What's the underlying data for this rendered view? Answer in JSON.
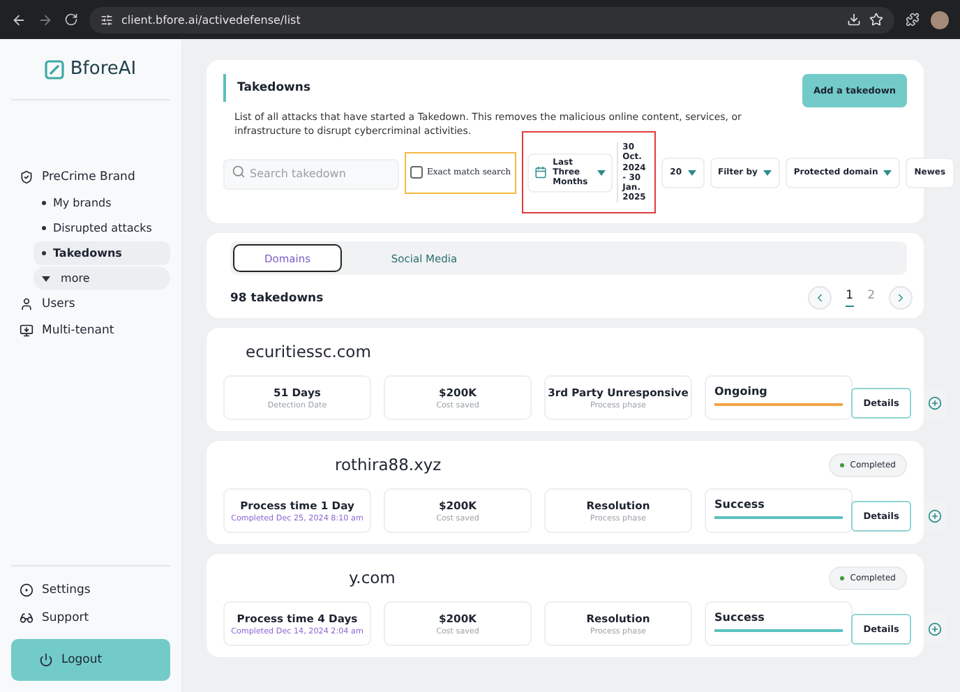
{
  "browser": {
    "url": "client.bfore.ai/activedefense/list"
  },
  "sidebar": {
    "logo": "BforeAI",
    "items": [
      {
        "label": "PreCrime Brand",
        "selected": false,
        "children": [
          {
            "label": "My brands",
            "kind": "sub",
            "selected": false
          },
          {
            "label": "Disrupted attacks",
            "kind": "sub",
            "selected": false
          },
          {
            "label": "Takedowns",
            "kind": "sub",
            "selected": true
          },
          {
            "label": "more",
            "kind": "more",
            "selected": false
          }
        ]
      },
      {
        "label": "Users",
        "selected": false
      },
      {
        "label": "Multi-tenant",
        "selected": false
      }
    ],
    "bottom": [
      {
        "label": "Settings"
      },
      {
        "label": "Support"
      }
    ],
    "logout": "Logout"
  },
  "header": {
    "title": "Takedowns",
    "description": "List of all attacks that have started a Takedown. This removes the malicious online content, services, or infrastructure to disrupt cybercriminal activities.",
    "add_button": "Add a takedown"
  },
  "filters": {
    "search_placeholder": "Search takedown",
    "exact_match": {
      "label": "Exact match search",
      "checked": false
    },
    "period": "Last Three Months",
    "date_range": "30 Oct. 2024 - 30 Jan. 2025",
    "page_size": "20",
    "filter_by": "Filter by",
    "protected_domain": "Protected domain",
    "sort": "Newes"
  },
  "tabs": [
    {
      "label": "Domains",
      "selected": true
    },
    {
      "label": "Social Media",
      "selected": false
    }
  ],
  "count": "98 takedowns",
  "pagination": {
    "pages": [
      {
        "label": "1",
        "selected": true
      },
      {
        "label": "2",
        "selected": false
      }
    ]
  },
  "takedowns": [
    {
      "domain": "ecuritiessc.com",
      "time": {
        "value": "51 Days",
        "label": "Detection Date",
        "kind": "detection"
      },
      "cost": {
        "value": "$200K",
        "label": "Cost saved"
      },
      "phase": {
        "value": "3rd Party Unresponsive",
        "label": "Process phase"
      },
      "status": {
        "label": "Ongoing",
        "kind": "ongoing"
      },
      "details": "Details"
    },
    {
      "domain": "rothira88.xyz",
      "badge": "Completed",
      "time": {
        "value": "Process time 1 Day",
        "label": "Completed Dec 25, 2024 8:10 am",
        "kind": "completed"
      },
      "cost": {
        "value": "$200K",
        "label": "Cost saved"
      },
      "phase": {
        "value": "Resolution",
        "label": "Process phase"
      },
      "status": {
        "label": "Success",
        "kind": "success"
      },
      "details": "Details"
    },
    {
      "domain": "y.com",
      "badge": "Completed",
      "time": {
        "value": "Process time 4 Days",
        "label": "Completed Dec 14, 2024 2:04 am",
        "kind": "completed"
      },
      "cost": {
        "value": "$200K",
        "label": "Cost saved"
      },
      "phase": {
        "value": "Resolution",
        "label": "Process phase"
      },
      "status": {
        "label": "Success",
        "kind": "success"
      },
      "details": "Details"
    }
  ]
}
